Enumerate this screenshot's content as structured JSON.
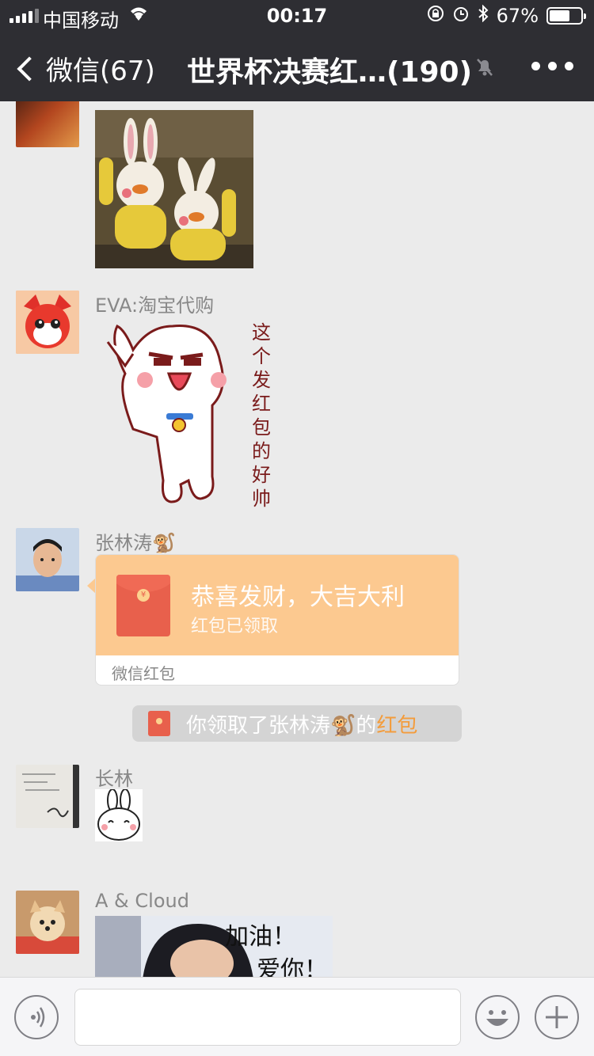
{
  "status": {
    "carrier": "中国移动",
    "time": "00:17",
    "battery": "67%",
    "battery_level": 0.67
  },
  "nav": {
    "back_label": "微信(67)",
    "title": "世界杯决赛红…(190)"
  },
  "messages": {
    "eva": {
      "sender": "EVA:淘宝代购",
      "sticker_text": "这个发红包的好帅"
    },
    "zhang": {
      "sender": "张林涛🐒",
      "red_packet_title": "恭喜发财，大吉大利",
      "red_packet_status": "红包已领取",
      "red_packet_source": "微信红包"
    },
    "system": {
      "prefix": "你领取了张林涛🐒的",
      "link": "红包"
    },
    "changlin": {
      "sender": "长林"
    },
    "acloud": {
      "sender": "A & Cloud",
      "image_text_1": "加油！",
      "image_text_2": "爱你！"
    }
  },
  "colors": {
    "nav_bg": "#2e2e33",
    "chat_bg": "#ebebeb",
    "red_packet": "#fcc990",
    "envelope": "#e8604c",
    "link": "#f39c3c"
  }
}
